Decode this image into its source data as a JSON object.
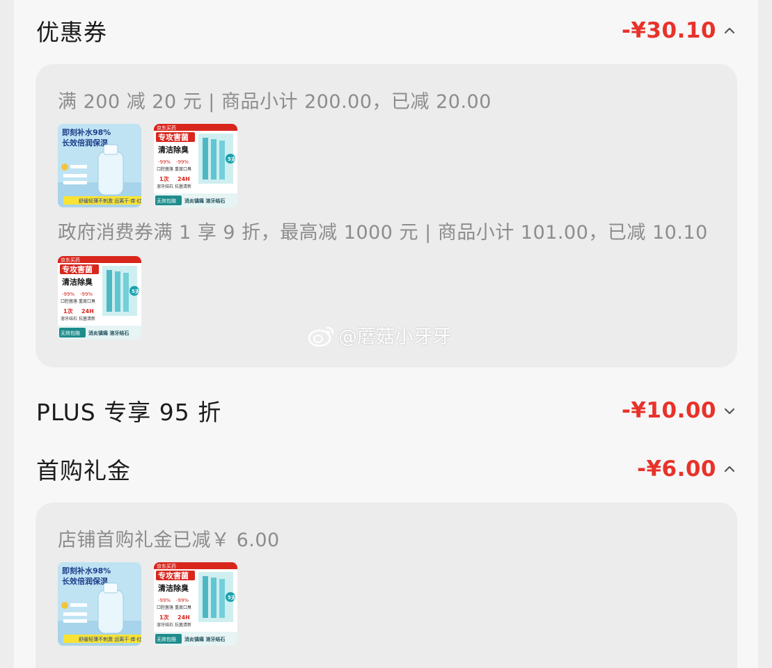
{
  "colors": {
    "accent_red": "#e8322a",
    "muted_text": "#8c8c8c",
    "panel_bg": "#ececec"
  },
  "coupon": {
    "title": "优惠券",
    "amount": "-¥30.10",
    "expanded": true,
    "rules": [
      {
        "text": "满 200 减 20 元 | 商品小计 200.00，已减 20.00",
        "products": [
          {
            "name": "hydration-spray",
            "headline1": "即刻补水98%",
            "headline2": "长效倍润保湿",
            "footer": "舒缓轻薄不刺激 远离干·痒·红"
          },
          {
            "name": "mouthwash",
            "brand": "京东买药",
            "headline1": "专攻害菌",
            "headline2": "清洁除臭",
            "stat1": "-99%",
            "stat2": "-99%",
            "sub1": "口腔菌落",
            "sub2": "重度口臭",
            "stat3": "1次",
            "stat4": "24H",
            "sub3": "溶牙结石",
            "sub4": "抗菌清新",
            "badge": "5支",
            "footer_left": "无效包赔",
            "footer_right": "消炎镇痛 溶牙结石"
          }
        ]
      },
      {
        "text": "政府消费券满 1 享 9 折，最高减 1000 元 | 商品小计 101.00，已减 10.10",
        "products": [
          {
            "name": "mouthwash",
            "brand": "京东买药",
            "headline1": "专攻害菌",
            "headline2": "清洁除臭",
            "stat1": "-99%",
            "stat2": "-99%",
            "sub1": "口腔菌落",
            "sub2": "重度口臭",
            "stat3": "1次",
            "stat4": "24H",
            "sub3": "溶牙结石",
            "sub4": "抗菌清新",
            "badge": "5支",
            "footer_left": "无效包赔",
            "footer_right": "消炎镇痛 溶牙结石"
          }
        ]
      }
    ]
  },
  "plus": {
    "title": "PLUS 专享 95 折",
    "amount": "-¥10.00",
    "expanded": false
  },
  "first_purchase": {
    "title": "首购礼金",
    "amount": "-¥6.00",
    "expanded": true,
    "text": "店铺首购礼金已减￥ 6.00",
    "products": [
      {
        "name": "hydration-spray",
        "headline1": "即刻补水98%",
        "headline2": "长效倍润保湿",
        "footer": "舒缓轻薄不刺激 远离干·痒·红"
      },
      {
        "name": "mouthwash",
        "brand": "京东买药",
        "headline1": "专攻害菌",
        "headline2": "清洁除臭",
        "stat1": "-99%",
        "stat2": "-99%",
        "sub1": "口腔菌落",
        "sub2": "重度口臭",
        "stat3": "1次",
        "stat4": "24H",
        "sub3": "溶牙结石",
        "sub4": "抗菌清新",
        "badge": "5支",
        "footer_left": "无效包赔",
        "footer_right": "消炎镇痛 溶牙结石"
      }
    ]
  },
  "watermark": {
    "text": "@蘑菇小牙牙",
    "icon": "weibo-logo-icon"
  }
}
